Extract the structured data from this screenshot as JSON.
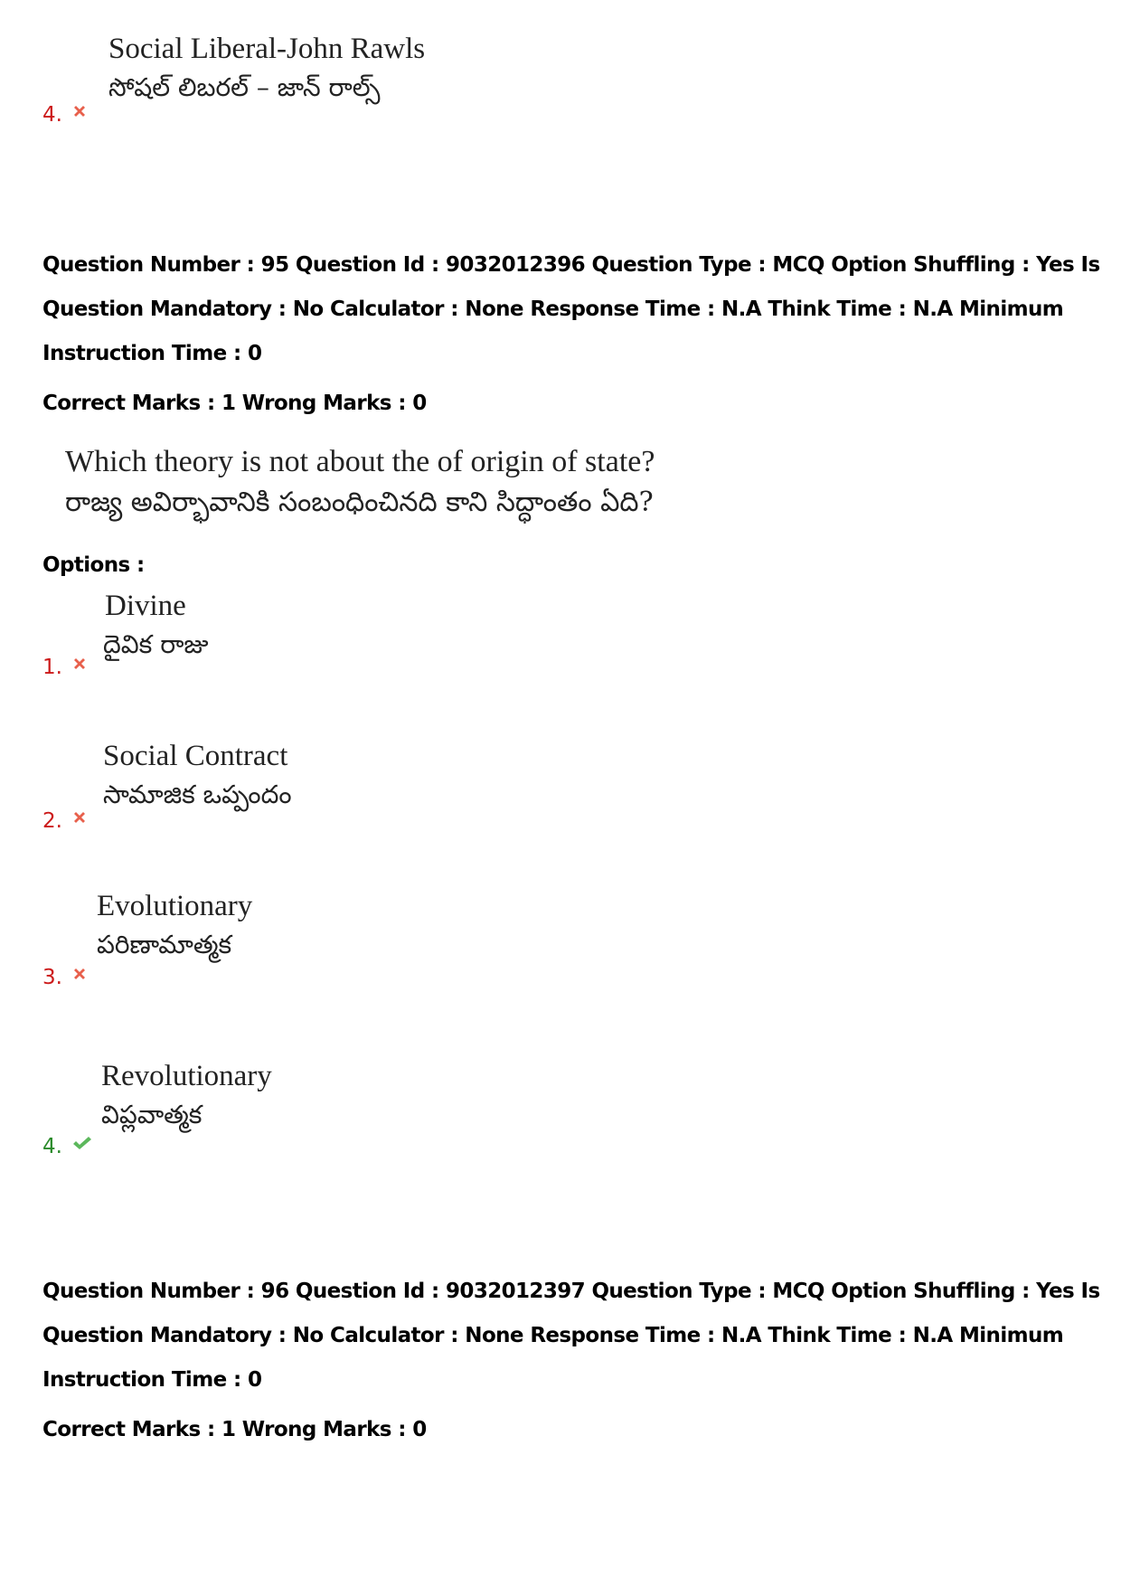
{
  "prev_question_tail": {
    "option": {
      "number": "4.",
      "status": "wrong",
      "icon": "cross-icon",
      "text_en": "Social Liberal-John Rawls",
      "text_te": "సోషల్ లిబరల్ – జాన్ రాల్స్"
    }
  },
  "question_95": {
    "meta_line1": "Question Number : 95 Question Id : 9032012396 Question Type : MCQ Option Shuffling : Yes Is",
    "meta_line2": "Question Mandatory : No Calculator : None Response Time : N.A Think Time : N.A Minimum",
    "meta_line3": "Instruction Time : 0",
    "marks": "Correct Marks : 1 Wrong Marks : 0",
    "question_en": "Which theory is not about the of origin of state?",
    "question_te": "రాజ్య అవిర్భావానికి సంబంధించినది కాని సిద్ధాంతం ఏది?",
    "options_label": "Options :",
    "options": [
      {
        "number": "1.",
        "status": "wrong",
        "icon": "cross-icon",
        "text_en": "Divine",
        "text_te": "దైవిక రాజు"
      },
      {
        "number": "2.",
        "status": "wrong",
        "icon": "cross-icon",
        "text_en": "Social Contract",
        "text_te": "సామాజిక ఒప్పందం"
      },
      {
        "number": "3.",
        "status": "wrong",
        "icon": "cross-icon",
        "text_en": "Evolutionary",
        "text_te": "పరిణామాత్మక"
      },
      {
        "number": "4.",
        "status": "correct",
        "icon": "check-icon",
        "text_en": "Revolutionary",
        "text_te": "విప్లవాత్మక"
      }
    ]
  },
  "question_96": {
    "meta_line1": "Question Number : 96 Question Id : 9032012397 Question Type : MCQ Option Shuffling : Yes Is",
    "meta_line2": "Question Mandatory : No Calculator : None Response Time : N.A Think Time : N.A Minimum",
    "meta_line3": "Instruction Time : 0",
    "marks": "Correct Marks : 1 Wrong Marks : 0"
  },
  "colors": {
    "wrong": "#cc1a1a",
    "wrong_icon": "#e8604c",
    "correct": "#2a8a2a",
    "correct_icon": "#5cb85c"
  }
}
